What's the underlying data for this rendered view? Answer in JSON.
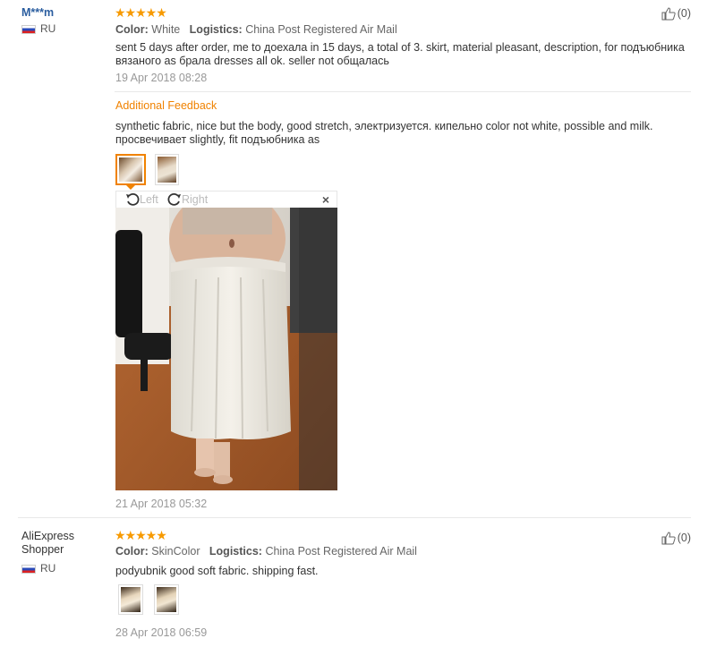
{
  "reviews": [
    {
      "user": "M***m",
      "country": "RU",
      "stars": "★★★★★",
      "color_label": "Color:",
      "color_value": "White",
      "logistics_label": "Logistics:",
      "logistics_value": "China Post Registered Air Mail",
      "text": "sent 5 days after order, me to доехала in 15 days, a total of 3. skirt, material pleasant, description, for подъюбника вязаного as брала dresses all ok. seller not общалась",
      "date": "19 Apr 2018 08:28",
      "likes": "(0)",
      "additional_label": "Additional Feedback",
      "additional_text": "synthetic fabric, nice but the body, good stretch, электризуется. кипельно color not white, possible and milk. просвечивает slightly, fit подъюбника as",
      "additional_date": "21 Apr 2018 05:32",
      "viewer": {
        "left_label": "Left",
        "right_label": "Right",
        "close_label": "×"
      }
    },
    {
      "user_line1": "AliExpress",
      "user_line2": "Shopper",
      "country": "RU",
      "stars": "★★★★★",
      "color_label": "Color:",
      "color_value": "SkinColor",
      "logistics_label": "Logistics:",
      "logistics_value": "China Post Registered Air Mail",
      "text": "podyubnik good soft fabric. shipping fast.",
      "date": "28 Apr 2018 06:59",
      "likes": "(0)"
    }
  ],
  "icons": {
    "thumbs_up": "thumbs-up-icon",
    "rotate_left": "rotate-left-icon",
    "rotate_right": "rotate-right-icon"
  },
  "colors": {
    "accent": "#f08200",
    "username": "#2a5d9f",
    "stars": "#f79a00"
  }
}
